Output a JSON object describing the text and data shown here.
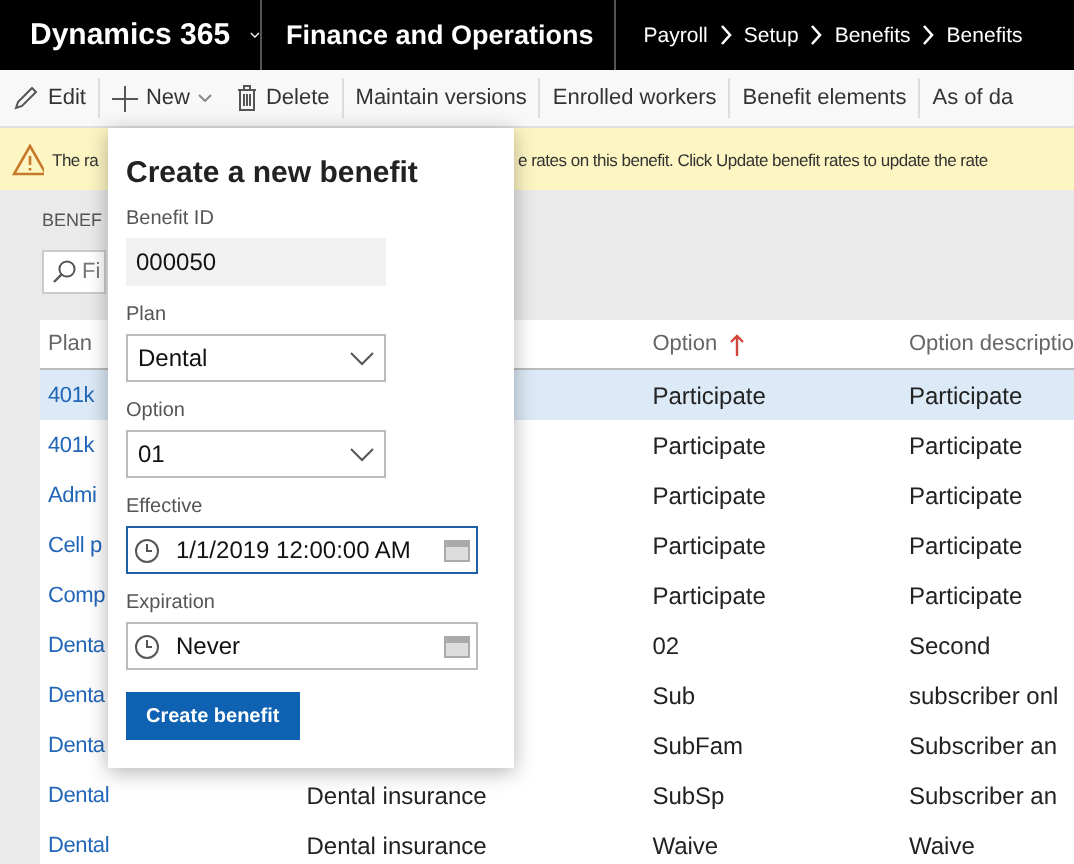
{
  "header": {
    "app": "Dynamics 365",
    "module": "Finance and Operations",
    "breadcrumb": [
      "Payroll",
      "Setup",
      "Benefits",
      "Benefits"
    ]
  },
  "toolbar": [
    {
      "label": "Edit",
      "kind": "edit"
    },
    {
      "label": "New",
      "kind": "new"
    },
    {
      "label": "Delete",
      "kind": "delete"
    },
    {
      "label": "Maintain versions",
      "kind": "text"
    },
    {
      "label": "Enrolled workers",
      "kind": "text"
    },
    {
      "label": "Benefit elements",
      "kind": "text"
    },
    {
      "label": "As of da",
      "kind": "text"
    }
  ],
  "message_bar": {
    "text_start": "The ra",
    "text_end": "e rates on this benefit. Click Update benefit rates to update the rate"
  },
  "section_label": "BENEF",
  "filter": {
    "placeholder": "Fi"
  },
  "grid": {
    "columns": {
      "plan": {
        "label": "Plan"
      },
      "option": {
        "label": "Option",
        "sorted": true
      },
      "option_description": {
        "label": "Option descriptio"
      }
    },
    "rows": [
      {
        "plan": "401k",
        "option": "Participate",
        "option_description": "Participate",
        "selected": true
      },
      {
        "plan": "401k",
        "option": "Participate",
        "option_description": "Participate",
        "selected": false
      },
      {
        "plan": "Admi",
        "option": "Participate",
        "option_description": "Participate",
        "selected": false
      },
      {
        "plan": "Cell p",
        "option": "Participate",
        "option_description": "Participate",
        "selected": false
      },
      {
        "plan": "Comp",
        "option": "Participate",
        "option_description": "Participate",
        "selected": false
      },
      {
        "plan": "Denta",
        "option": "02",
        "option_description": "Second",
        "selected": false
      },
      {
        "plan": "Denta",
        "option": "Sub",
        "option_description": "subscriber onl",
        "selected": false
      },
      {
        "plan": "Denta",
        "option": "SubFam",
        "option_description": "Subscriber an",
        "selected": false
      },
      {
        "plan": "Dental",
        "column_2": "Dental insurance",
        "option": "SubSp",
        "option_description": "Subscriber an",
        "selected": false
      },
      {
        "plan": "Dental",
        "column_2": "Dental insurance",
        "option": "Waive",
        "option_description": "Waive",
        "selected": false
      }
    ]
  },
  "dialog": {
    "title": "Create a new benefit",
    "fields": [
      {
        "kind": "readonly",
        "label": "Benefit ID",
        "value": "000050"
      },
      {
        "kind": "select",
        "label": "Plan",
        "value": "Dental"
      },
      {
        "kind": "select",
        "label": "Option",
        "value": "01"
      },
      {
        "kind": "datetime",
        "label": "Effective",
        "value": "1/1/2019 12:00:00 AM",
        "focused": true
      },
      {
        "kind": "datetime",
        "label": "Expiration",
        "value": "Never",
        "focused": false
      }
    ],
    "button": "Create benefit"
  }
}
